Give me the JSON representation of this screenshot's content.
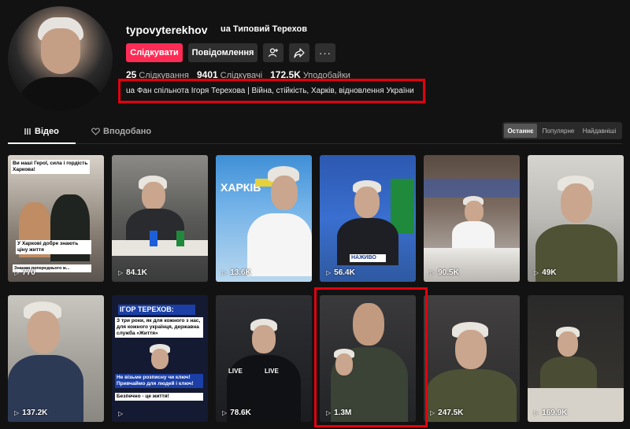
{
  "profile": {
    "username": "typovyterekhov",
    "nickname": "ua Типовий Терехов",
    "follow_label": "Слідкувати",
    "message_label": "Повідомлення",
    "stats": {
      "following_value": "25",
      "following_label": "Слідкування",
      "followers_value": "9401",
      "followers_label": "Слідкувачі",
      "likes_value": "172.5K",
      "likes_label": "Уподобайки"
    },
    "bio": "ua Фан спільнота Ігоря Терехова | Війна, стійкість, Харків, відновлення України"
  },
  "tabs": [
    {
      "label": "Відео",
      "icon": "grid-lines-icon"
    },
    {
      "label": "Вподобано",
      "icon": "heart-outline-icon"
    }
  ],
  "sort": [
    "Останнє",
    "Популярне",
    "Найдавніші"
  ],
  "videos": [
    {
      "views": "770",
      "caption_top": "Ви наші Герої, сила і гордість Харкова!",
      "caption_bottom": "У Харкові добре знають ціну життя",
      "caption_foot": "Знаємо попереднього ж..."
    },
    {
      "views": "84.1K"
    },
    {
      "views": "13.6K",
      "caption_top": "ХАРКІВ"
    },
    {
      "views": "56.4K",
      "caption_bottom": "НАЖИВО"
    },
    {
      "views": "90.5K"
    },
    {
      "views": "49K"
    },
    {
      "views": "137.2K"
    },
    {
      "views": "",
      "caption_top": "ІГОР ТЕРЕХОВ:",
      "caption_mid": "З три роки, як для кожного з нас, для кожного українця, державна служба «Життя»",
      "caption_bottom": "Не візьме розписну чи ключ! Привчаймо для людей і ключ!",
      "caption_foot": "Безпечно - це життя!"
    },
    {
      "views": "78.6K",
      "caption_mid": "LIVE"
    },
    {
      "views": "1.3M"
    },
    {
      "views": "247.5K"
    },
    {
      "views": "169.9K"
    }
  ]
}
